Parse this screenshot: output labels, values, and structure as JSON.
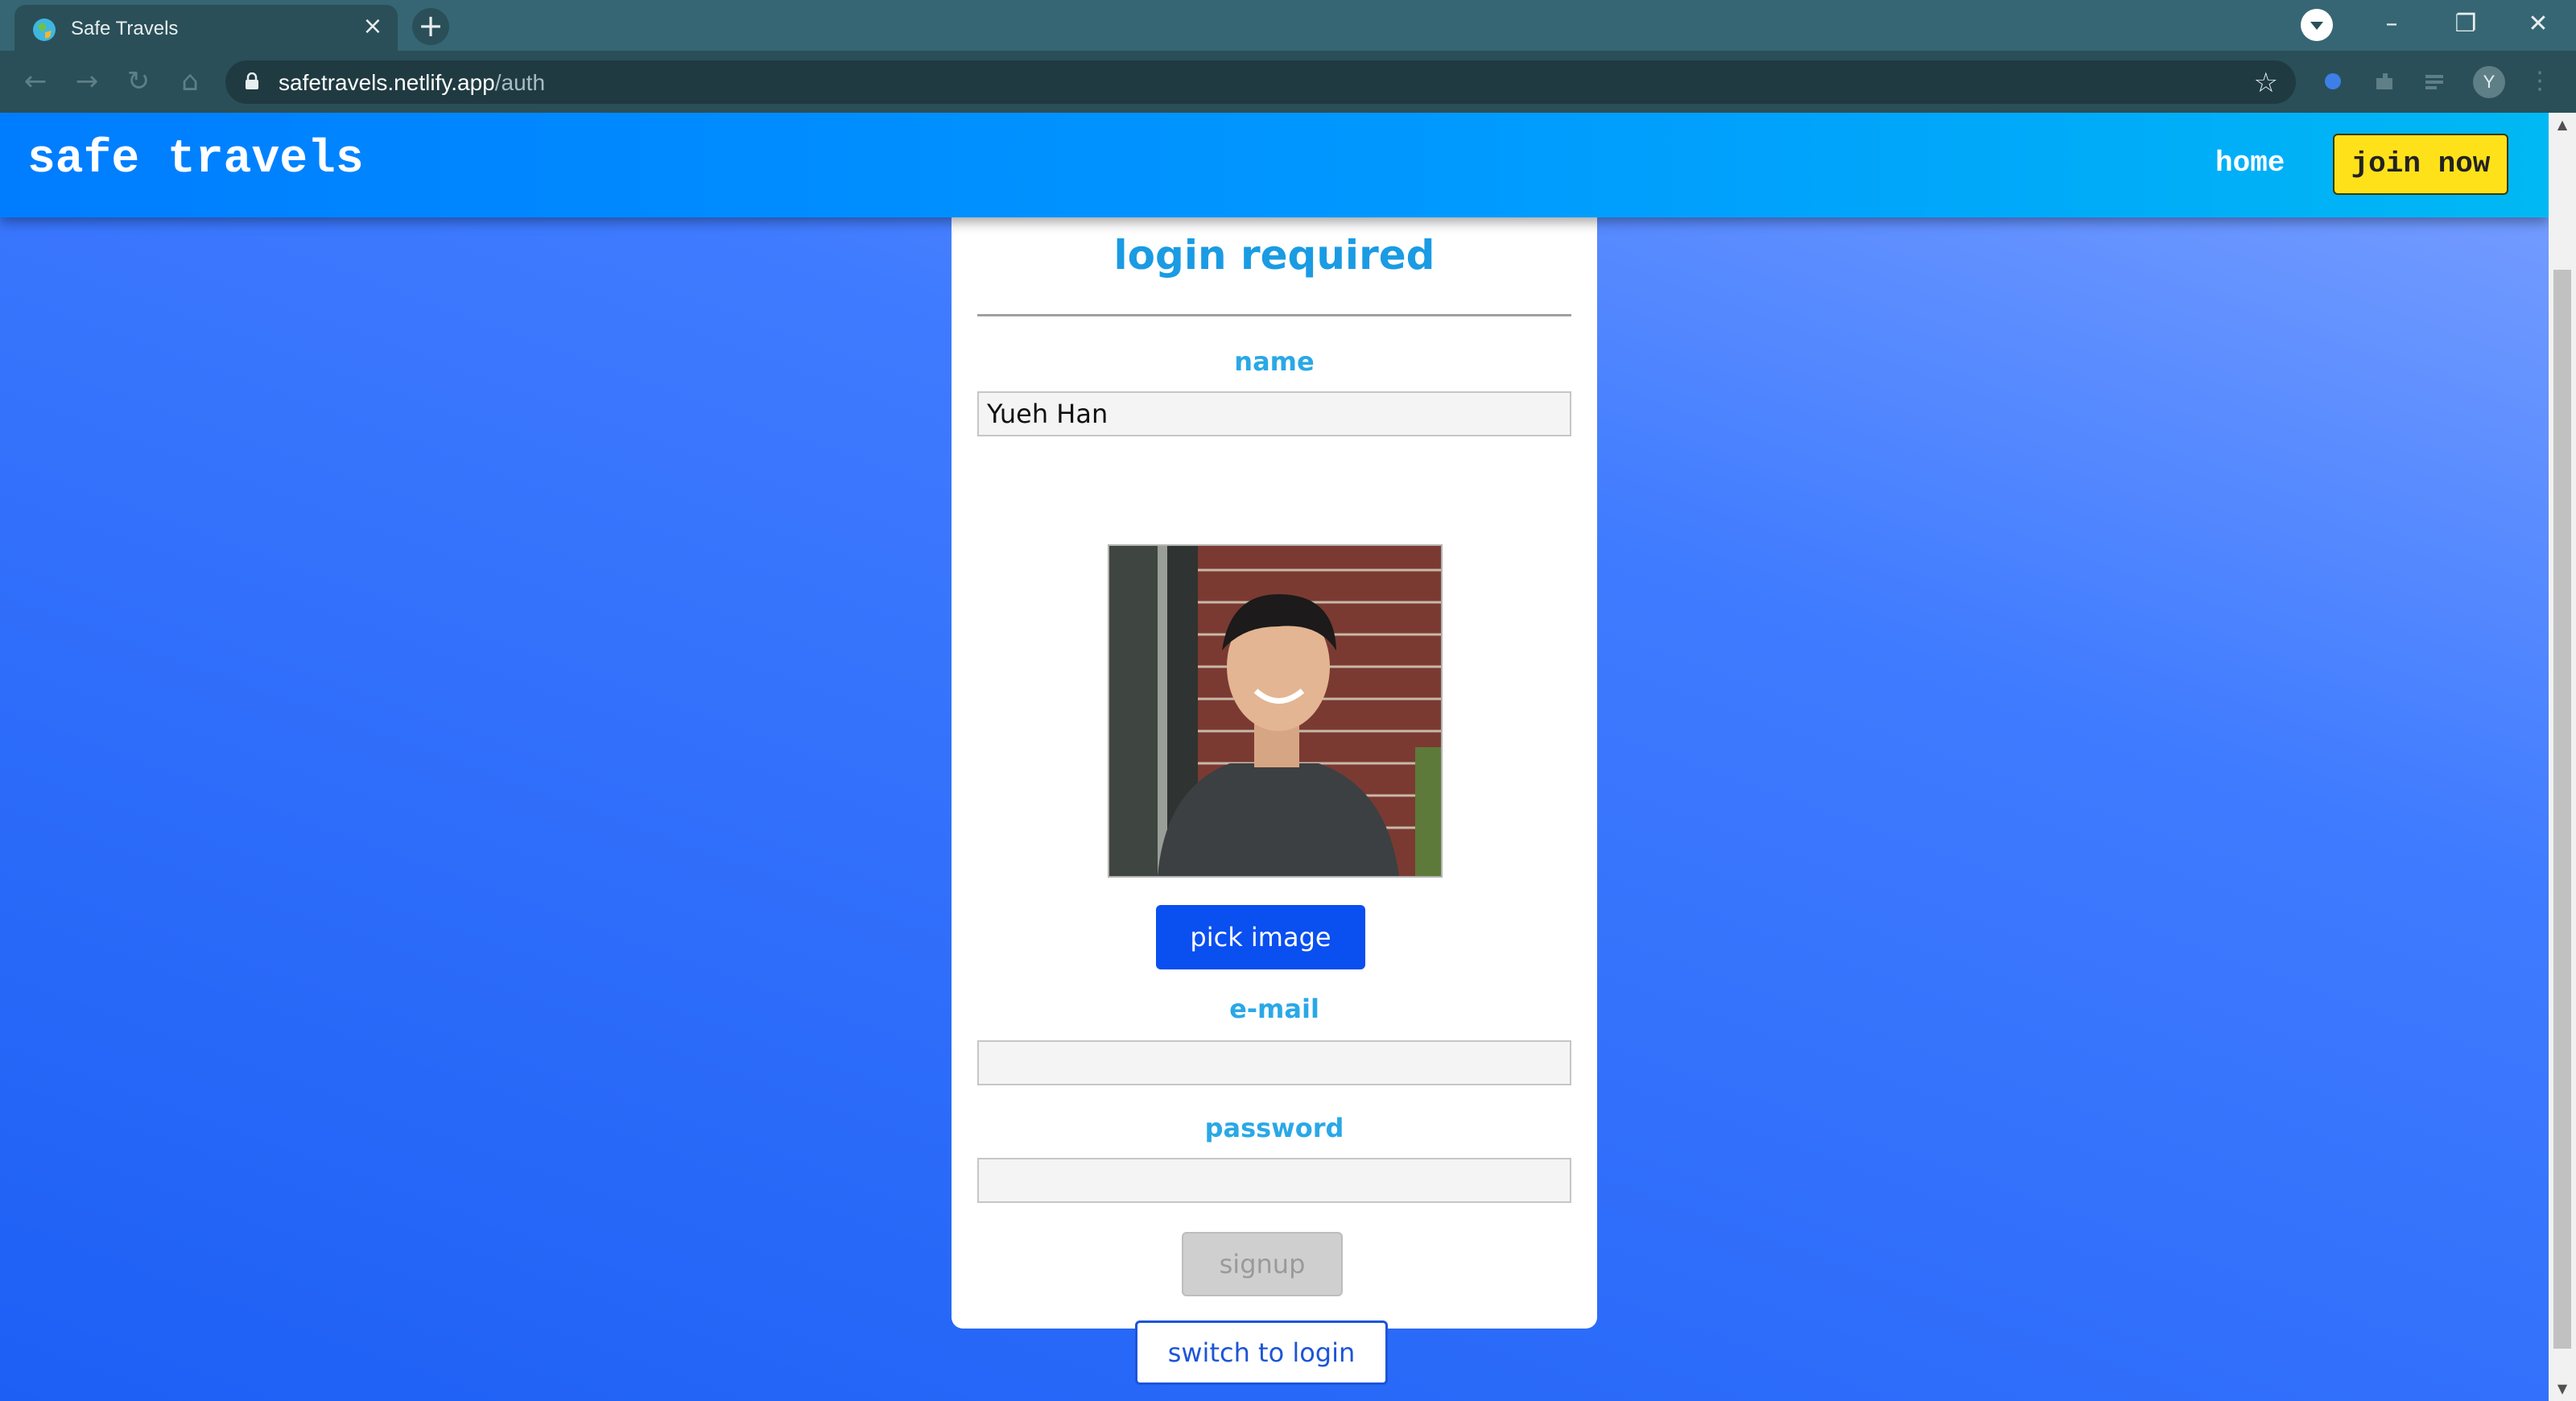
{
  "browser": {
    "tab_title": "Safe Travels",
    "url_host": "safetravels.netlify.app",
    "url_path": "/auth",
    "profile_initial": "Y"
  },
  "header": {
    "logo": "safe travels",
    "nav_home": "home",
    "nav_join": "join now"
  },
  "auth": {
    "title": "login required",
    "name_label": "name",
    "name_value": "Yueh Han",
    "pick_image_label": "pick image",
    "email_label": "e-mail",
    "email_value": "",
    "password_label": "password",
    "password_value": "",
    "signup_label": "signup",
    "switch_label": "switch to login"
  },
  "colors": {
    "accent_blue": "#0a4ff0",
    "header_gradient_start": "#007dff",
    "header_gradient_end": "#00b8f4",
    "join_button": "#ffe11a",
    "label_cyan": "#2aa8e6"
  },
  "icons": [
    "favicon-icon",
    "close-icon",
    "plus-icon",
    "lock-icon",
    "star-icon",
    "extension-icon",
    "kebab-menu-icon"
  ]
}
